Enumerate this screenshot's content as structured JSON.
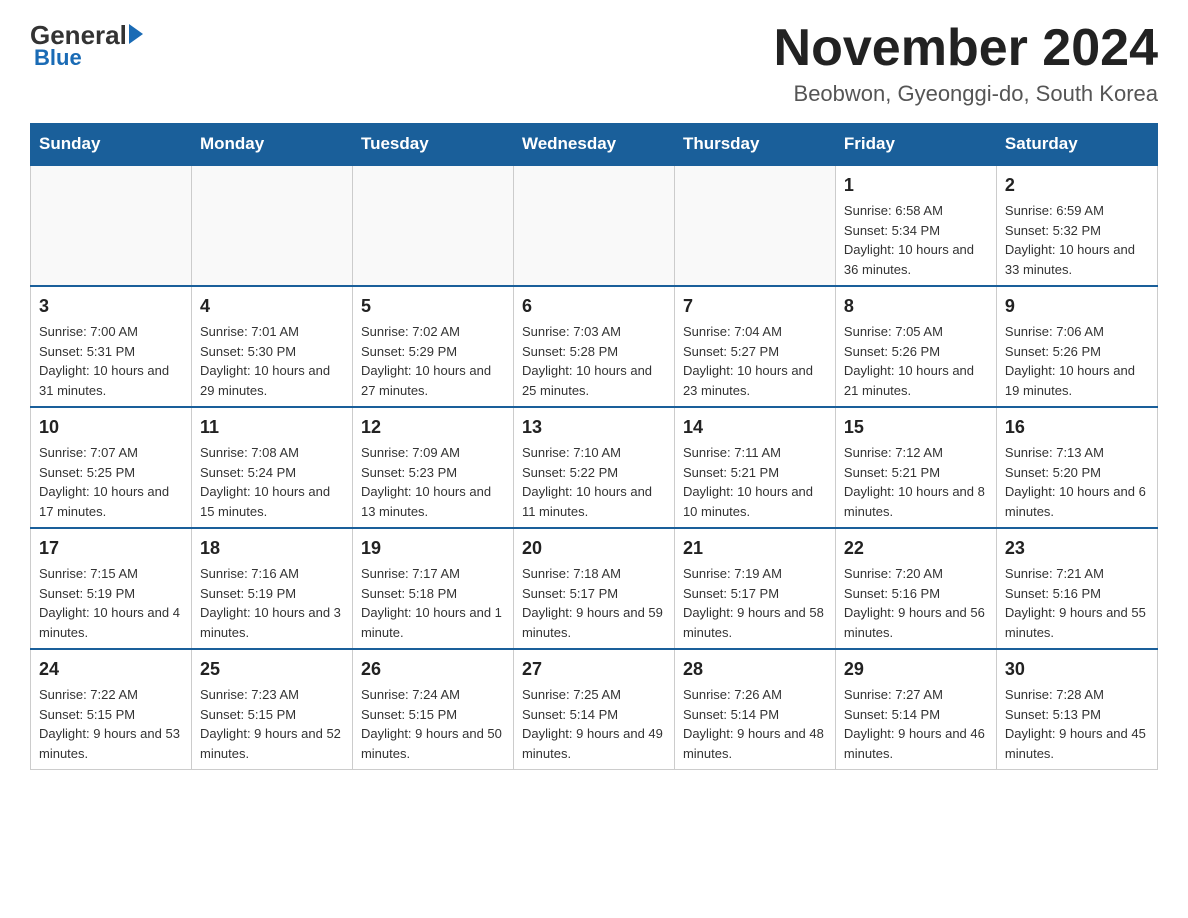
{
  "logo": {
    "general": "General",
    "blue": "Blue"
  },
  "header": {
    "title": "November 2024",
    "subtitle": "Beobwon, Gyeonggi-do, South Korea"
  },
  "days_of_week": [
    "Sunday",
    "Monday",
    "Tuesday",
    "Wednesday",
    "Thursday",
    "Friday",
    "Saturday"
  ],
  "weeks": [
    [
      {
        "day": "",
        "info": ""
      },
      {
        "day": "",
        "info": ""
      },
      {
        "day": "",
        "info": ""
      },
      {
        "day": "",
        "info": ""
      },
      {
        "day": "",
        "info": ""
      },
      {
        "day": "1",
        "info": "Sunrise: 6:58 AM\nSunset: 5:34 PM\nDaylight: 10 hours and 36 minutes."
      },
      {
        "day": "2",
        "info": "Sunrise: 6:59 AM\nSunset: 5:32 PM\nDaylight: 10 hours and 33 minutes."
      }
    ],
    [
      {
        "day": "3",
        "info": "Sunrise: 7:00 AM\nSunset: 5:31 PM\nDaylight: 10 hours and 31 minutes."
      },
      {
        "day": "4",
        "info": "Sunrise: 7:01 AM\nSunset: 5:30 PM\nDaylight: 10 hours and 29 minutes."
      },
      {
        "day": "5",
        "info": "Sunrise: 7:02 AM\nSunset: 5:29 PM\nDaylight: 10 hours and 27 minutes."
      },
      {
        "day": "6",
        "info": "Sunrise: 7:03 AM\nSunset: 5:28 PM\nDaylight: 10 hours and 25 minutes."
      },
      {
        "day": "7",
        "info": "Sunrise: 7:04 AM\nSunset: 5:27 PM\nDaylight: 10 hours and 23 minutes."
      },
      {
        "day": "8",
        "info": "Sunrise: 7:05 AM\nSunset: 5:26 PM\nDaylight: 10 hours and 21 minutes."
      },
      {
        "day": "9",
        "info": "Sunrise: 7:06 AM\nSunset: 5:26 PM\nDaylight: 10 hours and 19 minutes."
      }
    ],
    [
      {
        "day": "10",
        "info": "Sunrise: 7:07 AM\nSunset: 5:25 PM\nDaylight: 10 hours and 17 minutes."
      },
      {
        "day": "11",
        "info": "Sunrise: 7:08 AM\nSunset: 5:24 PM\nDaylight: 10 hours and 15 minutes."
      },
      {
        "day": "12",
        "info": "Sunrise: 7:09 AM\nSunset: 5:23 PM\nDaylight: 10 hours and 13 minutes."
      },
      {
        "day": "13",
        "info": "Sunrise: 7:10 AM\nSunset: 5:22 PM\nDaylight: 10 hours and 11 minutes."
      },
      {
        "day": "14",
        "info": "Sunrise: 7:11 AM\nSunset: 5:21 PM\nDaylight: 10 hours and 10 minutes."
      },
      {
        "day": "15",
        "info": "Sunrise: 7:12 AM\nSunset: 5:21 PM\nDaylight: 10 hours and 8 minutes."
      },
      {
        "day": "16",
        "info": "Sunrise: 7:13 AM\nSunset: 5:20 PM\nDaylight: 10 hours and 6 minutes."
      }
    ],
    [
      {
        "day": "17",
        "info": "Sunrise: 7:15 AM\nSunset: 5:19 PM\nDaylight: 10 hours and 4 minutes."
      },
      {
        "day": "18",
        "info": "Sunrise: 7:16 AM\nSunset: 5:19 PM\nDaylight: 10 hours and 3 minutes."
      },
      {
        "day": "19",
        "info": "Sunrise: 7:17 AM\nSunset: 5:18 PM\nDaylight: 10 hours and 1 minute."
      },
      {
        "day": "20",
        "info": "Sunrise: 7:18 AM\nSunset: 5:17 PM\nDaylight: 9 hours and 59 minutes."
      },
      {
        "day": "21",
        "info": "Sunrise: 7:19 AM\nSunset: 5:17 PM\nDaylight: 9 hours and 58 minutes."
      },
      {
        "day": "22",
        "info": "Sunrise: 7:20 AM\nSunset: 5:16 PM\nDaylight: 9 hours and 56 minutes."
      },
      {
        "day": "23",
        "info": "Sunrise: 7:21 AM\nSunset: 5:16 PM\nDaylight: 9 hours and 55 minutes."
      }
    ],
    [
      {
        "day": "24",
        "info": "Sunrise: 7:22 AM\nSunset: 5:15 PM\nDaylight: 9 hours and 53 minutes."
      },
      {
        "day": "25",
        "info": "Sunrise: 7:23 AM\nSunset: 5:15 PM\nDaylight: 9 hours and 52 minutes."
      },
      {
        "day": "26",
        "info": "Sunrise: 7:24 AM\nSunset: 5:15 PM\nDaylight: 9 hours and 50 minutes."
      },
      {
        "day": "27",
        "info": "Sunrise: 7:25 AM\nSunset: 5:14 PM\nDaylight: 9 hours and 49 minutes."
      },
      {
        "day": "28",
        "info": "Sunrise: 7:26 AM\nSunset: 5:14 PM\nDaylight: 9 hours and 48 minutes."
      },
      {
        "day": "29",
        "info": "Sunrise: 7:27 AM\nSunset: 5:14 PM\nDaylight: 9 hours and 46 minutes."
      },
      {
        "day": "30",
        "info": "Sunrise: 7:28 AM\nSunset: 5:13 PM\nDaylight: 9 hours and 45 minutes."
      }
    ]
  ]
}
